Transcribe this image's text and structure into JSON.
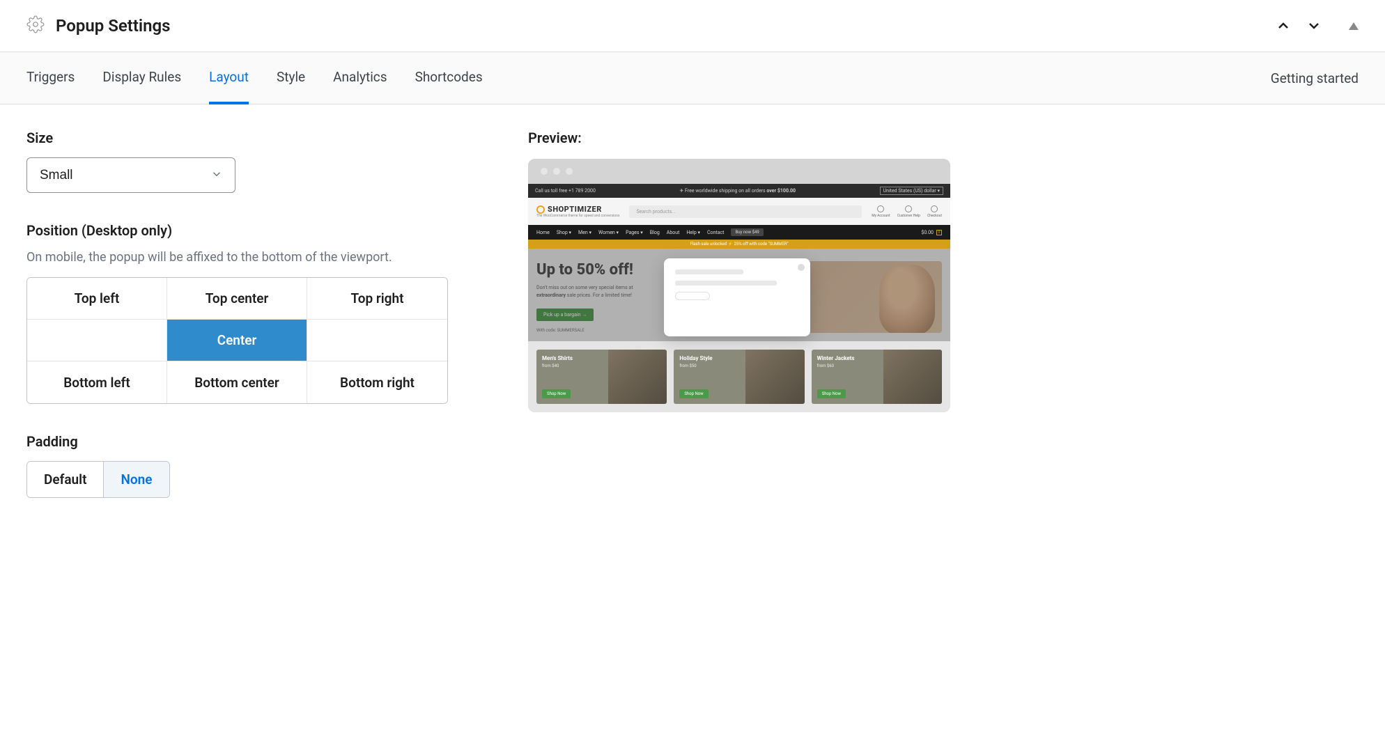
{
  "panel": {
    "title": "Popup Settings"
  },
  "tabs": {
    "items": [
      {
        "label": "Triggers"
      },
      {
        "label": "Display Rules"
      },
      {
        "label": "Layout"
      },
      {
        "label": "Style"
      },
      {
        "label": "Analytics"
      },
      {
        "label": "Shortcodes"
      }
    ],
    "active_index": 2,
    "getting_started": "Getting started"
  },
  "size": {
    "label": "Size",
    "value": "Small",
    "options": [
      "Small"
    ]
  },
  "position": {
    "label": "Position (Desktop only)",
    "help": "On mobile, the popup will be affixed to the bottom of the viewport.",
    "cells": [
      "Top left",
      "Top center",
      "Top right",
      "",
      "Center",
      "",
      "Bottom left",
      "Bottom center",
      "Bottom right"
    ],
    "selected_index": 4
  },
  "padding": {
    "label": "Padding",
    "options": [
      "Default",
      "None"
    ],
    "selected_index": 1
  },
  "preview": {
    "label": "Preview:",
    "topbar_left": "Call us toll free +1 789 2000",
    "topbar_center_prefix": "✈ Free worldwide shipping on all orders ",
    "topbar_center_bold": "over $100.00",
    "currency": "United States (US) dollar ▾",
    "brand": "SHOPTIMIZER",
    "tagline": "The WooCommerce theme for speed and conversions",
    "search_placeholder": "Search products...",
    "header_icons": [
      "My Account",
      "Customer Help",
      "Checkout"
    ],
    "nav": [
      "Home",
      "Shop ▾",
      "Men ▾",
      "Women ▾",
      "Pages ▾",
      "Blog",
      "About",
      "Help ▾",
      "Contact"
    ],
    "buy_now": "Buy now $49",
    "cart_total": "$0.00",
    "cart_count": "0",
    "flash": "Flash sale unlocked ⚡ 25% off with code \"SUMMER\"",
    "hero_title": "Up to 50% off!",
    "hero_sub_1": "Don't miss out on some very special items at ",
    "hero_sub_bold": "extraordinary",
    "hero_sub_2": " sale prices. For a limited time!",
    "hero_btn": "Pick up a bargain →",
    "hero_code": "With code: SUMMERSALE",
    "cards": [
      {
        "title": "Men's Shirts",
        "price": "from $40",
        "btn": "Shop Now"
      },
      {
        "title": "Holiday Style",
        "price": "from $50",
        "btn": "Shop Now"
      },
      {
        "title": "Winter Jackets",
        "price": "from $60",
        "btn": "Shop Now"
      }
    ]
  }
}
